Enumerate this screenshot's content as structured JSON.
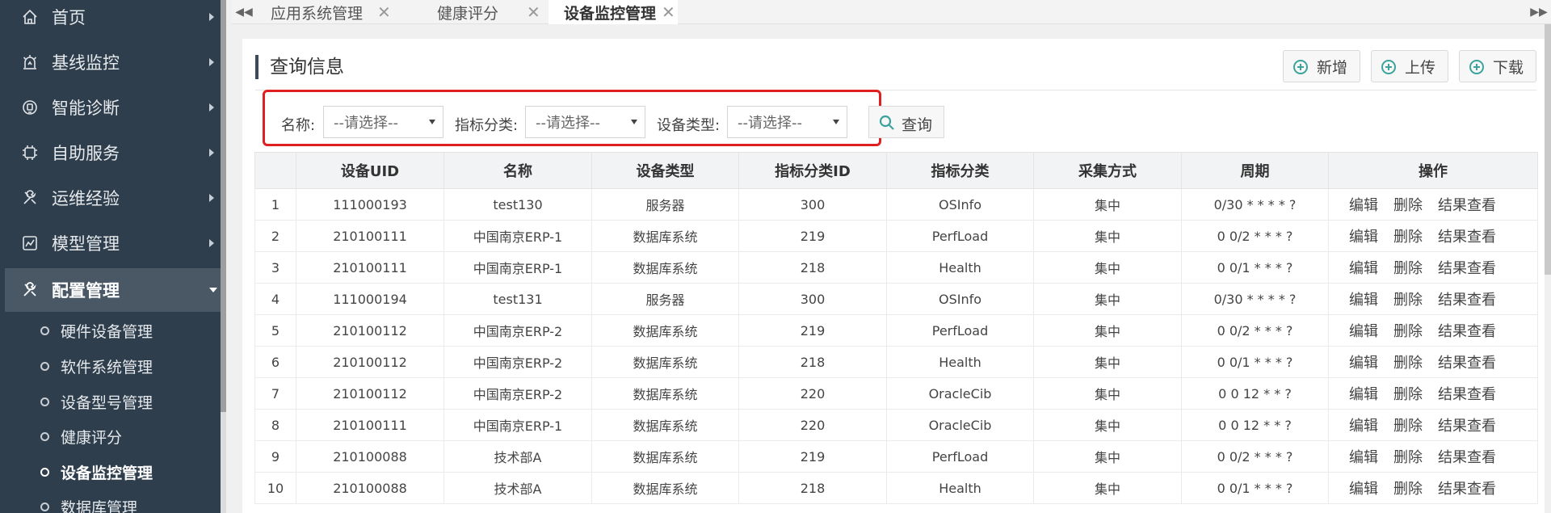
{
  "sidebar": {
    "items": [
      {
        "label": "首页",
        "icon": "home-icon"
      },
      {
        "label": "基线监控",
        "icon": "monitor-alarm-icon"
      },
      {
        "label": "智能诊断",
        "icon": "diagnosis-icon"
      },
      {
        "label": "自助服务",
        "icon": "chip-icon"
      },
      {
        "label": "运维经验",
        "icon": "tools-icon"
      },
      {
        "label": "模型管理",
        "icon": "chart-icon"
      },
      {
        "label": "配置管理",
        "icon": "config-tools-icon"
      }
    ],
    "sub_items": [
      {
        "label": "硬件设备管理"
      },
      {
        "label": "软件系统管理"
      },
      {
        "label": "设备型号管理"
      },
      {
        "label": "健康评分"
      },
      {
        "label": "设备监控管理"
      },
      {
        "label": "数据库管理"
      }
    ]
  },
  "tabs": [
    {
      "label": "应用系统管理"
    },
    {
      "label": "健康评分"
    },
    {
      "label": "设备监控管理"
    }
  ],
  "panel": {
    "title": "查询信息",
    "buttons": {
      "add": "新增",
      "upload": "上传",
      "download": "下载"
    }
  },
  "filters": {
    "name_label": "名称:",
    "category_label": "指标分类:",
    "device_type_label": "设备类型:",
    "placeholder": "--请选择--",
    "query_label": "查询"
  },
  "table": {
    "headers": [
      "",
      "设备UID",
      "名称",
      "设备类型",
      "指标分类ID",
      "指标分类",
      "采集方式",
      "周期",
      "操作"
    ],
    "actions": {
      "edit": "编辑",
      "delete": "删除",
      "view": "结果查看"
    },
    "rows": [
      [
        "1",
        "111000193",
        "test130",
        "服务器",
        "300",
        "OSInfo",
        "集中",
        "0/30 * * * * ?"
      ],
      [
        "2",
        "210100111",
        "中国南京ERP-1",
        "数据库系统",
        "219",
        "PerfLoad",
        "集中",
        "0 0/2 * * * ?"
      ],
      [
        "3",
        "210100111",
        "中国南京ERP-1",
        "数据库系统",
        "218",
        "Health",
        "集中",
        "0 0/1 * * * ?"
      ],
      [
        "4",
        "111000194",
        "test131",
        "服务器",
        "300",
        "OSInfo",
        "集中",
        "0/30 * * * * ?"
      ],
      [
        "5",
        "210100112",
        "中国南京ERP-2",
        "数据库系统",
        "219",
        "PerfLoad",
        "集中",
        "0 0/2 * * * ?"
      ],
      [
        "6",
        "210100112",
        "中国南京ERP-2",
        "数据库系统",
        "218",
        "Health",
        "集中",
        "0 0/1 * * * ?"
      ],
      [
        "7",
        "210100112",
        "中国南京ERP-2",
        "数据库系统",
        "220",
        "OracleCib",
        "集中",
        "0 0 12 * * ?"
      ],
      [
        "8",
        "210100111",
        "中国南京ERP-1",
        "数据库系统",
        "220",
        "OracleCib",
        "集中",
        "0 0 12 * * ?"
      ],
      [
        "9",
        "210100088",
        "技术部A",
        "数据库系统",
        "219",
        "PerfLoad",
        "集中",
        "0 0/2 * * * ?"
      ],
      [
        "10",
        "210100088",
        "技术部A",
        "数据库系统",
        "218",
        "Health",
        "集中",
        "0 0/1 * * * ?"
      ]
    ]
  }
}
